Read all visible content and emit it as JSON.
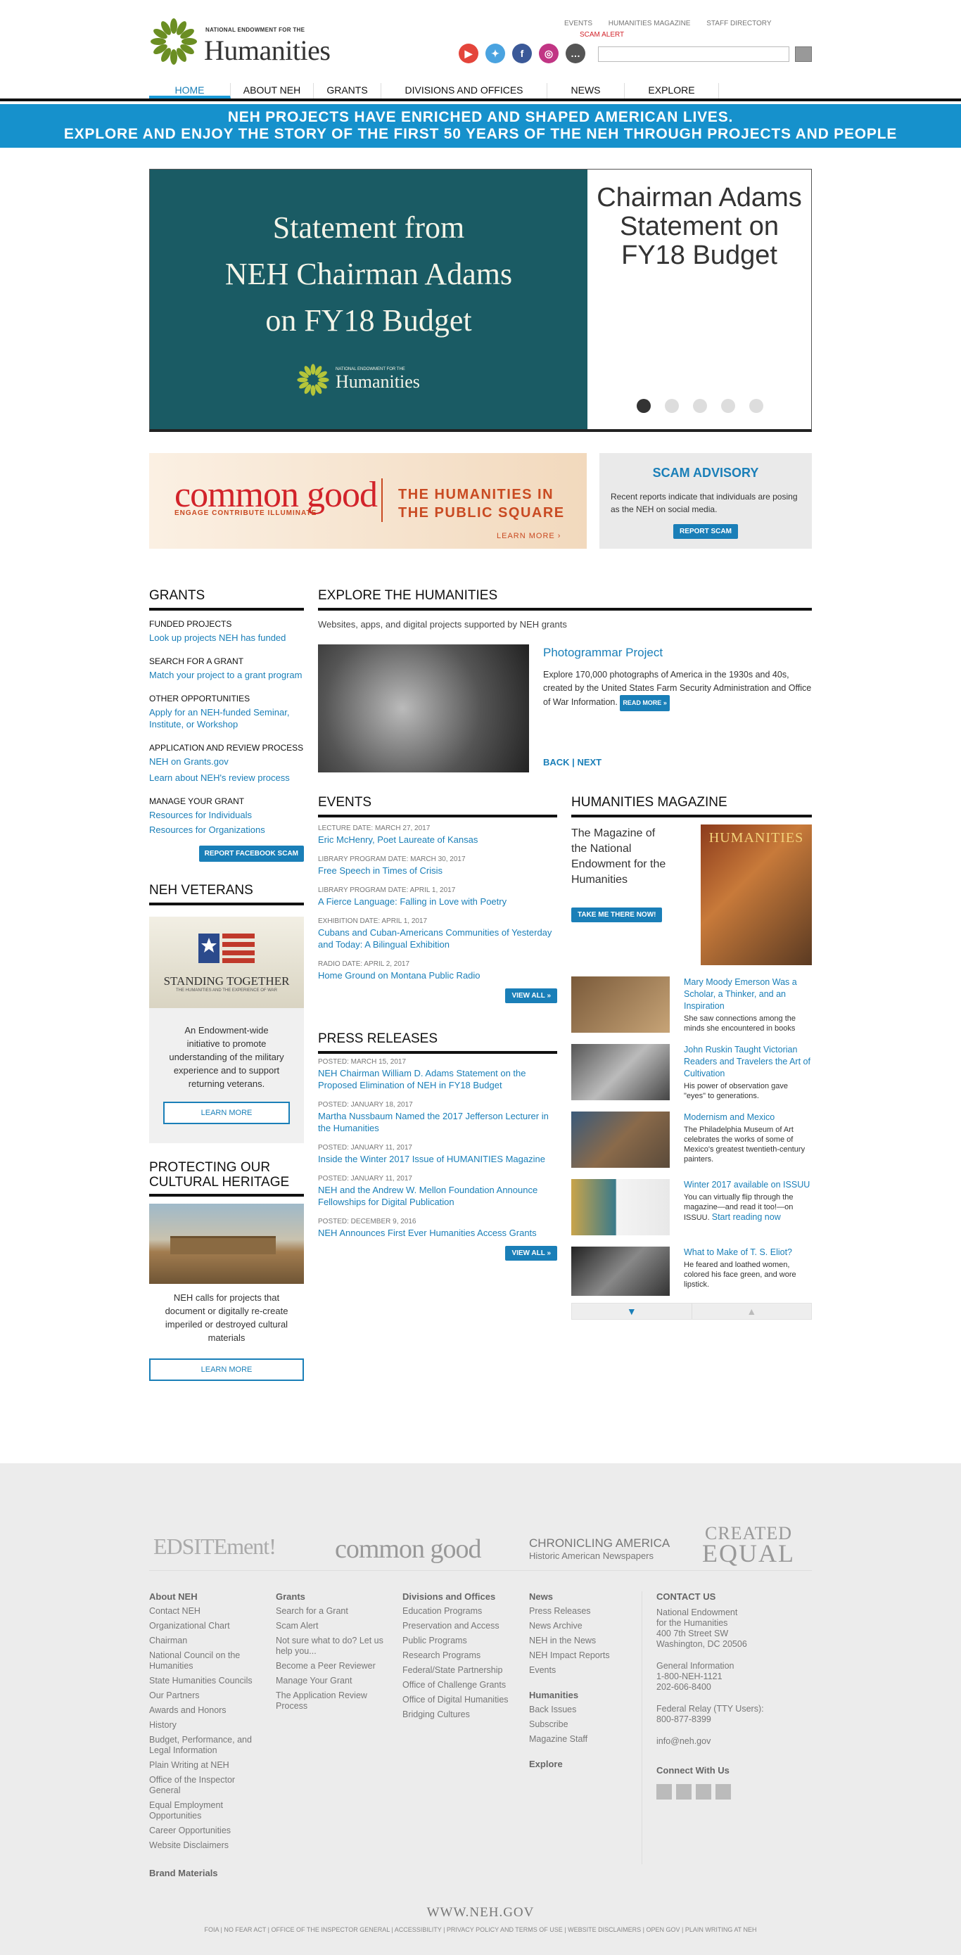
{
  "header": {
    "logo_small": "NATIONAL ENDOWMENT FOR THE",
    "logo_big": "Humanities",
    "top_links": [
      "EVENTS",
      "HUMANITIES MAGAZINE",
      "STAFF DIRECTORY"
    ],
    "scam_alert": "SCAM ALERT"
  },
  "nav": [
    "HOME",
    "ABOUT NEH",
    "GRANTS",
    "DIVISIONS AND OFFICES",
    "NEWS",
    "EXPLORE"
  ],
  "banner": {
    "line1": "NEH PROJECTS HAVE ENRICHED AND SHAPED AMERICAN LIVES.",
    "line2": "EXPLORE AND ENJOY THE STORY OF THE FIRST 50 YEARS OF THE NEH THROUGH PROJECTS AND PEOPLE"
  },
  "hero": {
    "slide_l1": "Statement from",
    "slide_l2": "NEH Chairman Adams",
    "slide_l3": "on FY18 Budget",
    "slide_logo_small": "NATIONAL ENDOWMENT FOR THE",
    "slide_logo": "Humanities",
    "side_title": "Chairman Adams Statement on FY18 Budget"
  },
  "promo": {
    "cg_word": "common good",
    "cg_sub": "ENGAGE   CONTRIBUTE   ILLUMINATE",
    "cg_right1": "THE HUMANITIES IN",
    "cg_right2": "THE PUBLIC SQUARE",
    "cg_learn": "LEARN MORE ›",
    "scam_title": "SCAM ADVISORY",
    "scam_text": "Recent reports indicate that individuals are posing as the NEH on social media.",
    "scam_btn": "REPORT SCAM"
  },
  "grants": {
    "title": "GRANTS",
    "sections": [
      {
        "h": "FUNDED PROJECTS",
        "links": [
          "Look up projects NEH has funded"
        ]
      },
      {
        "h": "SEARCH FOR A GRANT",
        "links": [
          "Match your project to a grant program"
        ]
      },
      {
        "h": "OTHER OPPORTUNITIES",
        "links": [
          "Apply for an NEH-funded Seminar, Institute, or Workshop"
        ]
      },
      {
        "h": "APPLICATION AND REVIEW PROCESS",
        "links": [
          "NEH on Grants.gov",
          "Learn about NEH's review process"
        ]
      },
      {
        "h": "MANAGE YOUR GRANT",
        "links": [
          "Resources for Individuals",
          "Resources for Organizations"
        ]
      }
    ],
    "fb_btn": "REPORT FACEBOOK SCAM"
  },
  "veterans": {
    "title": "NEH VETERANS",
    "img_title": "STANDING TOGETHER",
    "img_sub": "THE HUMANITIES AND THE EXPERIENCE OF WAR",
    "text": "An Endowment-wide initiative to promote understanding of the military experience and to support returning veterans.",
    "btn": "LEARN MORE"
  },
  "heritage": {
    "title": "PROTECTING OUR CULTURAL HERITAGE",
    "text": "NEH calls for projects that document or digitally re-create imperiled or destroyed cultural materials",
    "btn": "LEARN MORE"
  },
  "explore": {
    "title": "EXPLORE THE HUMANITIES",
    "subtitle": "Websites, apps, and digital projects supported by NEH grants",
    "proj_title": "Photogrammar Project",
    "proj_text": "Explore 170,000 photographs of America in the 1930s and 40s, created by the United States Farm Security Administration and Office of War Information.",
    "read_more": "READ MORE »",
    "back": "BACK",
    "next": "NEXT"
  },
  "events": {
    "title": "EVENTS",
    "items": [
      {
        "meta": "LECTURE DATE: MARCH 27, 2017",
        "t": "Eric McHenry, Poet Laureate of Kansas"
      },
      {
        "meta": "LIBRARY PROGRAM DATE: MARCH 30, 2017",
        "t": "Free Speech in Times of Crisis"
      },
      {
        "meta": "LIBRARY PROGRAM DATE: APRIL 1, 2017",
        "t": "A Fierce Language: Falling in Love with Poetry"
      },
      {
        "meta": "EXHIBITION DATE: APRIL 1, 2017",
        "t": "Cubans and Cuban-Americans Communities of Yesterday and Today: A Bilingual Exhibition"
      },
      {
        "meta": "RADIO DATE: APRIL 2, 2017",
        "t": "Home Ground on Montana Public Radio"
      }
    ],
    "view_all": "VIEW ALL »"
  },
  "press": {
    "title": "PRESS RELEASES",
    "items": [
      {
        "meta": "POSTED: MARCH 15, 2017",
        "t": "NEH Chairman William D. Adams Statement on the Proposed Elimination of NEH in FY18 Budget"
      },
      {
        "meta": "POSTED: JANUARY 18, 2017",
        "t": "Martha Nussbaum Named the 2017 Jefferson Lecturer in the Humanities"
      },
      {
        "meta": "POSTED: JANUARY 11, 2017",
        "t": "Inside the Winter 2017 Issue of HUMANITIES Magazine"
      },
      {
        "meta": "POSTED: JANUARY 11, 2017",
        "t": "NEH and the Andrew W. Mellon Foundation Announce Fellowships for Digital Publication"
      },
      {
        "meta": "POSTED: DECEMBER 9, 2016",
        "t": "NEH Announces First Ever Humanities Access Grants"
      }
    ],
    "view_all": "VIEW ALL »"
  },
  "magazine": {
    "title": "HUMANITIES MAGAZINE",
    "tagline": "The Magazine of the National Endowment for the Humanities",
    "btn": "TAKE ME THERE NOW!",
    "cover_title": "HUMANITIES",
    "articles": [
      {
        "t": "Mary Moody Emerson Was a Scholar, a Thinker, and an Inspiration",
        "d": "She saw connections among the minds she encountered in books"
      },
      {
        "t": "John Ruskin Taught Victorian Readers and Travelers the Art of Cultivation",
        "d": "His power of observation gave \"eyes\" to generations."
      },
      {
        "t": "Modernism and Mexico",
        "d": "The Philadelphia Museum of Art celebrates the works of some of Mexico's greatest twentieth-century painters."
      },
      {
        "t": "Winter 2017 available on ISSUU",
        "d": "You can virtually flip through the magazine—and read it too!—on ISSUU.",
        "link": "Start reading now"
      },
      {
        "t": "What to Make of T. S. Eliot?",
        "d": "He feared and loathed women, colored his face green, and wore lipstick."
      }
    ]
  },
  "partners": [
    "EDSITEment!",
    "common good",
    "CHRONICLING AMERICA",
    "Historic American Newspapers",
    "CREATED",
    "EQUAL"
  ],
  "footer": {
    "cols": [
      {
        "h": "About NEH",
        "links": [
          "Contact NEH",
          "Organizational Chart",
          "Chairman",
          "National Council on the Humanities",
          "State Humanities Councils",
          "Our Partners",
          "Awards and Honors",
          "History",
          "Budget, Performance, and Legal Information",
          "Plain Writing at NEH",
          "Office of the Inspector General",
          "Equal Employment Opportunities",
          "Career Opportunities",
          "Website Disclaimers"
        ]
      },
      {
        "h": "Grants",
        "links": [
          "Search for a Grant",
          "Scam Alert",
          "Not sure what to do? Let us help you...",
          "Become a Peer Reviewer",
          "Manage Your Grant",
          "The Application Review Process"
        ]
      },
      {
        "h": "Divisions and Offices",
        "links": [
          "Education Programs",
          "Preservation and Access",
          "Public Programs",
          "Research Programs",
          "Federal/State Partnership",
          "Office of Challenge Grants",
          "Office of Digital Humanities",
          "Bridging Cultures"
        ]
      },
      {
        "h": "News",
        "links": [
          "Press Releases",
          "News Archive",
          "NEH in the News",
          "NEH Impact Reports",
          "Events"
        ]
      }
    ],
    "humanities_h": "Humanities",
    "humanities_links": [
      "Back Issues",
      "Subscribe",
      "Magazine Staff"
    ],
    "explore_h": "Explore",
    "brand": "Brand Materials",
    "contact_h": "CONTACT US",
    "contact_addr": [
      "National Endowment",
      "for the Humanities",
      "400 7th Street SW",
      "Washington, DC 20506"
    ],
    "contact_gen": [
      "General Information",
      "1-800-NEH-1121",
      "202-606-8400"
    ],
    "relay": [
      "Federal Relay (TTY Users):",
      "800-877-8399"
    ],
    "email": "info@neh.gov",
    "connect": "Connect With Us",
    "site": "WWW.NEH.GOV",
    "bottom": "FOIA | NO FEAR ACT | OFFICE OF THE INSPECTOR GENERAL | ACCESSIBILITY | PRIVACY POLICY AND TERMS OF USE | WEBSITE DISCLAIMERS | OPEN GOV | PLAIN WRITING AT NEH"
  }
}
